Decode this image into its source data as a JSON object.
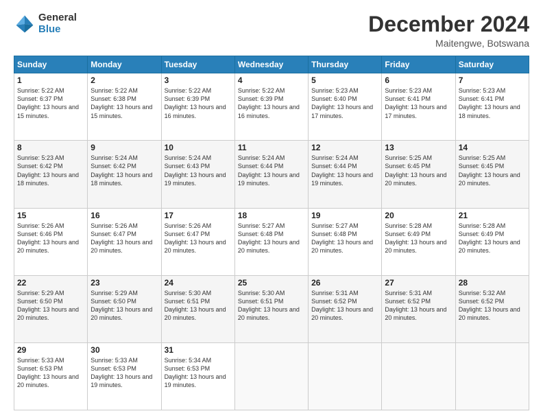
{
  "logo": {
    "general": "General",
    "blue": "Blue"
  },
  "title": "December 2024",
  "location": "Maitengwe, Botswana",
  "days_of_week": [
    "Sunday",
    "Monday",
    "Tuesday",
    "Wednesday",
    "Thursday",
    "Friday",
    "Saturday"
  ],
  "weeks": [
    [
      {
        "day": "1",
        "sunrise": "5:22 AM",
        "sunset": "6:37 PM",
        "daylight": "13 hours and 15 minutes."
      },
      {
        "day": "2",
        "sunrise": "5:22 AM",
        "sunset": "6:38 PM",
        "daylight": "13 hours and 15 minutes."
      },
      {
        "day": "3",
        "sunrise": "5:22 AM",
        "sunset": "6:39 PM",
        "daylight": "13 hours and 16 minutes."
      },
      {
        "day": "4",
        "sunrise": "5:22 AM",
        "sunset": "6:39 PM",
        "daylight": "13 hours and 16 minutes."
      },
      {
        "day": "5",
        "sunrise": "5:23 AM",
        "sunset": "6:40 PM",
        "daylight": "13 hours and 17 minutes."
      },
      {
        "day": "6",
        "sunrise": "5:23 AM",
        "sunset": "6:41 PM",
        "daylight": "13 hours and 17 minutes."
      },
      {
        "day": "7",
        "sunrise": "5:23 AM",
        "sunset": "6:41 PM",
        "daylight": "13 hours and 18 minutes."
      }
    ],
    [
      {
        "day": "8",
        "sunrise": "5:23 AM",
        "sunset": "6:42 PM",
        "daylight": "13 hours and 18 minutes."
      },
      {
        "day": "9",
        "sunrise": "5:24 AM",
        "sunset": "6:42 PM",
        "daylight": "13 hours and 18 minutes."
      },
      {
        "day": "10",
        "sunrise": "5:24 AM",
        "sunset": "6:43 PM",
        "daylight": "13 hours and 19 minutes."
      },
      {
        "day": "11",
        "sunrise": "5:24 AM",
        "sunset": "6:44 PM",
        "daylight": "13 hours and 19 minutes."
      },
      {
        "day": "12",
        "sunrise": "5:24 AM",
        "sunset": "6:44 PM",
        "daylight": "13 hours and 19 minutes."
      },
      {
        "day": "13",
        "sunrise": "5:25 AM",
        "sunset": "6:45 PM",
        "daylight": "13 hours and 20 minutes."
      },
      {
        "day": "14",
        "sunrise": "5:25 AM",
        "sunset": "6:45 PM",
        "daylight": "13 hours and 20 minutes."
      }
    ],
    [
      {
        "day": "15",
        "sunrise": "5:26 AM",
        "sunset": "6:46 PM",
        "daylight": "13 hours and 20 minutes."
      },
      {
        "day": "16",
        "sunrise": "5:26 AM",
        "sunset": "6:47 PM",
        "daylight": "13 hours and 20 minutes."
      },
      {
        "day": "17",
        "sunrise": "5:26 AM",
        "sunset": "6:47 PM",
        "daylight": "13 hours and 20 minutes."
      },
      {
        "day": "18",
        "sunrise": "5:27 AM",
        "sunset": "6:48 PM",
        "daylight": "13 hours and 20 minutes."
      },
      {
        "day": "19",
        "sunrise": "5:27 AM",
        "sunset": "6:48 PM",
        "daylight": "13 hours and 20 minutes."
      },
      {
        "day": "20",
        "sunrise": "5:28 AM",
        "sunset": "6:49 PM",
        "daylight": "13 hours and 20 minutes."
      },
      {
        "day": "21",
        "sunrise": "5:28 AM",
        "sunset": "6:49 PM",
        "daylight": "13 hours and 20 minutes."
      }
    ],
    [
      {
        "day": "22",
        "sunrise": "5:29 AM",
        "sunset": "6:50 PM",
        "daylight": "13 hours and 20 minutes."
      },
      {
        "day": "23",
        "sunrise": "5:29 AM",
        "sunset": "6:50 PM",
        "daylight": "13 hours and 20 minutes."
      },
      {
        "day": "24",
        "sunrise": "5:30 AM",
        "sunset": "6:51 PM",
        "daylight": "13 hours and 20 minutes."
      },
      {
        "day": "25",
        "sunrise": "5:30 AM",
        "sunset": "6:51 PM",
        "daylight": "13 hours and 20 minutes."
      },
      {
        "day": "26",
        "sunrise": "5:31 AM",
        "sunset": "6:52 PM",
        "daylight": "13 hours and 20 minutes."
      },
      {
        "day": "27",
        "sunrise": "5:31 AM",
        "sunset": "6:52 PM",
        "daylight": "13 hours and 20 minutes."
      },
      {
        "day": "28",
        "sunrise": "5:32 AM",
        "sunset": "6:52 PM",
        "daylight": "13 hours and 20 minutes."
      }
    ],
    [
      {
        "day": "29",
        "sunrise": "5:33 AM",
        "sunset": "6:53 PM",
        "daylight": "13 hours and 20 minutes."
      },
      {
        "day": "30",
        "sunrise": "5:33 AM",
        "sunset": "6:53 PM",
        "daylight": "13 hours and 19 minutes."
      },
      {
        "day": "31",
        "sunrise": "5:34 AM",
        "sunset": "6:53 PM",
        "daylight": "13 hours and 19 minutes."
      },
      null,
      null,
      null,
      null
    ]
  ]
}
